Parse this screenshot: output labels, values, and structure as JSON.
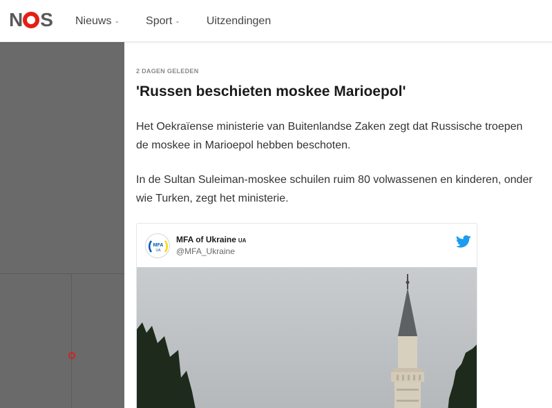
{
  "header": {
    "logo_text": "NOS",
    "nav": [
      {
        "label": "Nieuws",
        "has_dropdown": true
      },
      {
        "label": "Sport",
        "has_dropdown": true
      },
      {
        "label": "Uitzendingen",
        "has_dropdown": false
      }
    ]
  },
  "article": {
    "timestamp": "2 DAGEN GELEDEN",
    "title": "'Russen beschieten moskee Marioepol'",
    "paragraphs": [
      "Het Oekraïense ministerie van Buitenlandse Zaken zegt dat Russische troepen de moskee in Marioepol hebben beschoten.",
      "In de Sultan Suleiman-moskee schuilen ruim 80 volwassenen en kinderen, onder wie Turken, zegt het ministerie."
    ]
  },
  "tweet": {
    "name": "MFA of Ukraine",
    "name_suffix": "UA",
    "handle": "@MFA_Ukraine",
    "avatar_text": "MFA",
    "avatar_sub": "UA",
    "icon": "twitter-bird-icon",
    "image_subject": "minaret-photo"
  },
  "colors": {
    "brand_red": "#e61e14",
    "twitter_blue": "#1d9bf0",
    "left_panel": "#6a6a6a"
  }
}
